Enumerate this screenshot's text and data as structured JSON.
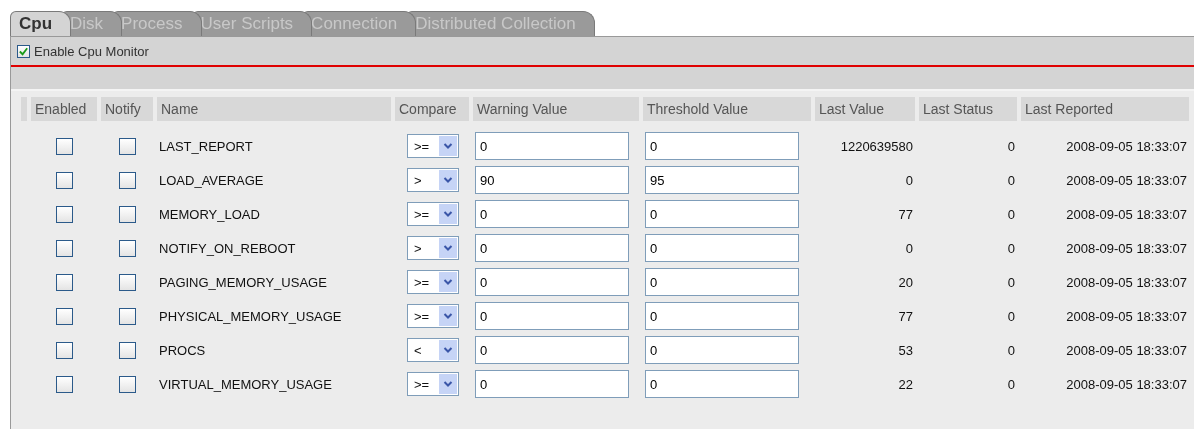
{
  "tabs": [
    {
      "label": "Cpu",
      "selected": true
    },
    {
      "label": "Disk",
      "selected": false
    },
    {
      "label": "Process",
      "selected": false
    },
    {
      "label": "User Scripts",
      "selected": false
    },
    {
      "label": "Connection",
      "selected": false
    },
    {
      "label": "Distributed Collection",
      "selected": false
    }
  ],
  "enable_monitor": {
    "label": "Enable Cpu Monitor",
    "checked": true
  },
  "table": {
    "columns": [
      "Enabled",
      "Notify",
      "Name",
      "Compare",
      "Warning Value",
      "Threshold Value",
      "Last Value",
      "Last Status",
      "Last Reported"
    ],
    "rows": [
      {
        "enabled": false,
        "notify": false,
        "name": "LAST_REPORT",
        "compare": ">=",
        "warning": "0",
        "threshold": "0",
        "last_value": "1220639580",
        "last_status": "0",
        "last_reported": "2008-09-05 18:33:07"
      },
      {
        "enabled": false,
        "notify": false,
        "name": "LOAD_AVERAGE",
        "compare": ">",
        "warning": "90",
        "threshold": "95",
        "last_value": "0",
        "last_status": "0",
        "last_reported": "2008-09-05 18:33:07"
      },
      {
        "enabled": false,
        "notify": false,
        "name": "MEMORY_LOAD",
        "compare": ">=",
        "warning": "0",
        "threshold": "0",
        "last_value": "77",
        "last_status": "0",
        "last_reported": "2008-09-05 18:33:07"
      },
      {
        "enabled": false,
        "notify": false,
        "name": "NOTIFY_ON_REBOOT",
        "compare": ">",
        "warning": "0",
        "threshold": "0",
        "last_value": "0",
        "last_status": "0",
        "last_reported": "2008-09-05 18:33:07"
      },
      {
        "enabled": false,
        "notify": false,
        "name": "PAGING_MEMORY_USAGE",
        "compare": ">=",
        "warning": "0",
        "threshold": "0",
        "last_value": "20",
        "last_status": "0",
        "last_reported": "2008-09-05 18:33:07"
      },
      {
        "enabled": false,
        "notify": false,
        "name": "PHYSICAL_MEMORY_USAGE",
        "compare": ">=",
        "warning": "0",
        "threshold": "0",
        "last_value": "77",
        "last_status": "0",
        "last_reported": "2008-09-05 18:33:07"
      },
      {
        "enabled": false,
        "notify": false,
        "name": "PROCS",
        "compare": "<",
        "warning": "0",
        "threshold": "0",
        "last_value": "53",
        "last_status": "0",
        "last_reported": "2008-09-05 18:33:07"
      },
      {
        "enabled": false,
        "notify": false,
        "name": "VIRTUAL_MEMORY_USAGE",
        "compare": ">=",
        "warning": "0",
        "threshold": "0",
        "last_value": "22",
        "last_status": "0",
        "last_reported": "2008-09-05 18:33:07"
      }
    ]
  }
}
